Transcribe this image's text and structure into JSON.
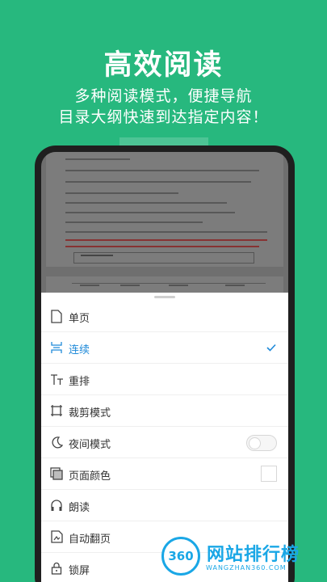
{
  "hero": {
    "title": "高效阅读",
    "subtitle_line1": "多种阅读模式，便捷导航",
    "subtitle_line2": "目录大纲快速到达指定内容！"
  },
  "menu": {
    "items": [
      {
        "label": "单页",
        "icon": "single-page-icon"
      },
      {
        "label": "连续",
        "icon": "continuous-icon",
        "selected": true
      },
      {
        "label": "重排",
        "icon": "reflow-icon"
      },
      {
        "label": "裁剪模式",
        "icon": "crop-icon"
      },
      {
        "label": "夜间模式",
        "icon": "moon-icon",
        "toggle": false
      },
      {
        "label": "页面颜色",
        "icon": "page-color-icon"
      },
      {
        "label": "朗读",
        "icon": "headphones-icon"
      },
      {
        "label": "自动翻页",
        "icon": "auto-page-icon"
      },
      {
        "label": "锁屏",
        "icon": "lock-icon"
      }
    ]
  },
  "watermark": {
    "logo_text": "360",
    "name": "网站排行榜",
    "url": "WANGZHAN360.COM"
  },
  "colors": {
    "background": "#27b87e",
    "accent": "#1f8ad9",
    "watermark": "#1aa7e6"
  }
}
